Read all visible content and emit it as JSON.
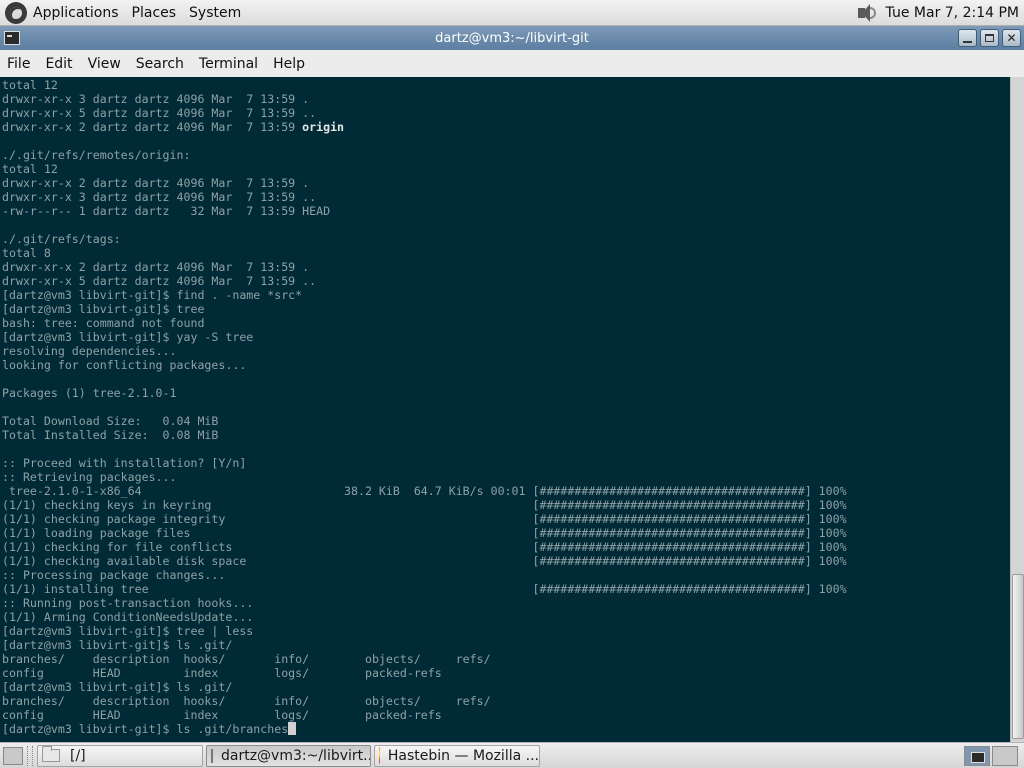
{
  "top_panel": {
    "menus": [
      "Applications",
      "Places",
      "System"
    ],
    "clock": "Tue Mar  7,  2:14 PM"
  },
  "window": {
    "title": "dartz@vm3:~/libvirt-git"
  },
  "menu_bar": {
    "items": [
      "File",
      "Edit",
      "View",
      "Search",
      "Terminal",
      "Help"
    ]
  },
  "terminal": {
    "background": "#002b36",
    "foreground": "#8fa0a6",
    "lines": [
      "total 12",
      "drwxr-xr-x 3 dartz dartz 4096 Mar  7 13:59 .",
      "drwxr-xr-x 5 dartz dartz 4096 Mar  7 13:59 ..",
      "drwxr-xr-x 2 dartz dartz 4096 Mar  7 13:59 ",
      "",
      "./.git/refs/remotes/origin:",
      "total 12",
      "drwxr-xr-x 2 dartz dartz 4096 Mar  7 13:59 .",
      "drwxr-xr-x 3 dartz dartz 4096 Mar  7 13:59 ..",
      "-rw-r--r-- 1 dartz dartz   32 Mar  7 13:59 HEAD",
      "",
      "./.git/refs/tags:",
      "total 8",
      "drwxr-xr-x 2 dartz dartz 4096 Mar  7 13:59 .",
      "drwxr-xr-x 5 dartz dartz 4096 Mar  7 13:59 ..",
      "[dartz@vm3 libvirt-git]$ find . -name *src*",
      "[dartz@vm3 libvirt-git]$ tree",
      "bash: tree: command not found",
      "[dartz@vm3 libvirt-git]$ yay -S tree",
      "resolving dependencies...",
      "looking for conflicting packages...",
      "",
      "Packages (1) tree-2.1.0-1",
      "",
      "Total Download Size:   0.04 MiB",
      "Total Installed Size:  0.08 MiB",
      "",
      ":: Proceed with installation? [Y/n]",
      ":: Retrieving packages...",
      " tree-2.1.0-1-x86_64                             38.2 KiB  64.7 KiB/s 00:01 [######################################] 100%",
      "(1/1) checking keys in keyring                                              [######################################] 100%",
      "(1/1) checking package integrity                                            [######################################] 100%",
      "(1/1) loading package files                                                 [######################################] 100%",
      "(1/1) checking for file conflicts                                           [######################################] 100%",
      "(1/1) checking available disk space                                         [######################################] 100%",
      ":: Processing package changes...",
      "(1/1) installing tree                                                       [######################################] 100%",
      ":: Running post-transaction hooks...",
      "(1/1) Arming ConditionNeedsUpdate...",
      "[dartz@vm3 libvirt-git]$ tree | less",
      "[dartz@vm3 libvirt-git]$ ls .git/",
      "branches/    description  hooks/       info/        objects/     refs/",
      "config       HEAD         index        logs/        packed-refs",
      "[dartz@vm3 libvirt-git]$ ls .git/",
      "branches/    description  hooks/       info/        objects/     refs/",
      "config       HEAD         index        logs/        packed-refs",
      "[dartz@vm3 libvirt-git]$ ls .git/branches"
    ],
    "bold_suffix": {
      "line_index": 3,
      "text": "origin"
    }
  },
  "taskbar": {
    "tasks": [
      {
        "label": "[/]",
        "icon": "folder-icon"
      },
      {
        "label": "dartz@vm3:~/libvirt...",
        "icon": "terminal-icon"
      },
      {
        "label": "Hastebin — Mozilla ...",
        "icon": "firefox-icon"
      }
    ]
  }
}
